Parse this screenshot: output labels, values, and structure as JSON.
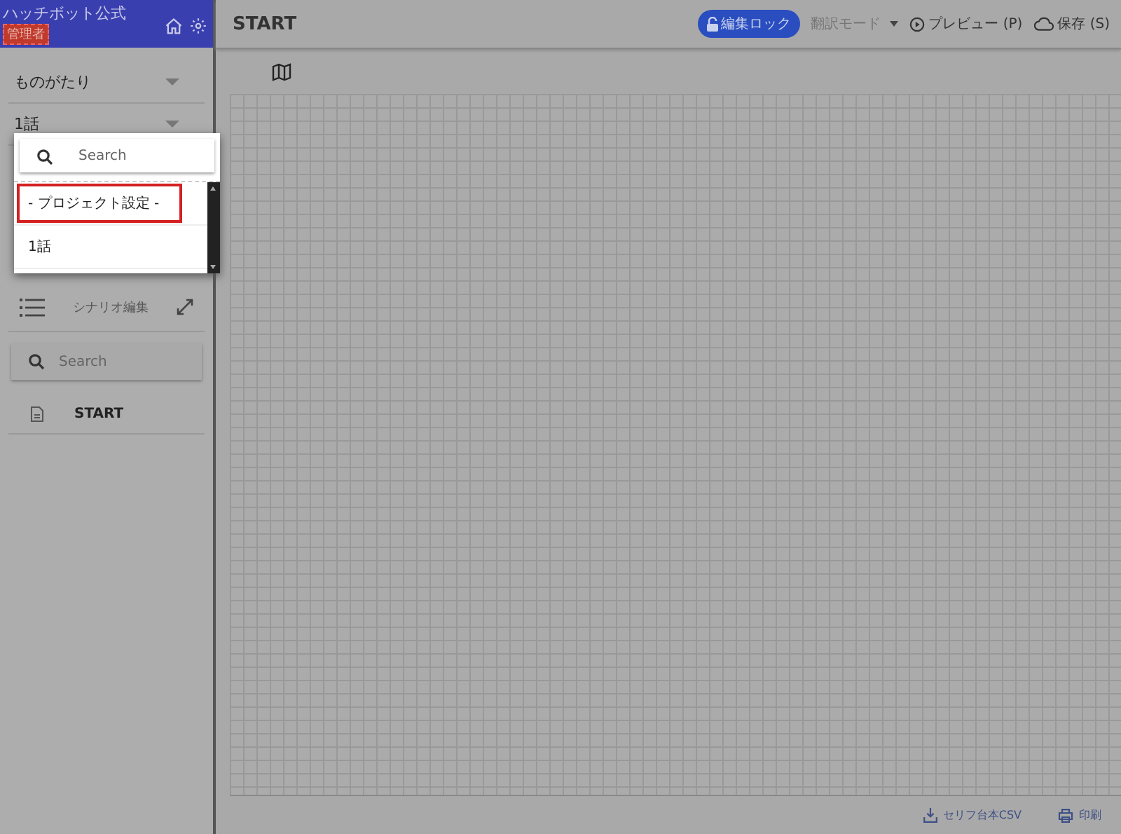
{
  "sidebar": {
    "app_title": "ハッチボット公式",
    "role_badge": "管理者",
    "selects": [
      {
        "label": "ものがたり"
      },
      {
        "label": "1話"
      }
    ],
    "scenario_label": "シナリオ編集",
    "search": {
      "placeholder": "Search"
    },
    "scenes": [
      {
        "label": "START"
      }
    ]
  },
  "dropdown": {
    "search": {
      "placeholder": "Search"
    },
    "options": [
      {
        "label": "- プロジェクト設定 -",
        "selected": true
      },
      {
        "label": "1話",
        "selected": false
      }
    ]
  },
  "header": {
    "title": "START",
    "edit_lock": "編集ロック",
    "translation_mode": "翻訳モード",
    "preview": "プレビュー (P)",
    "save": "保存 (S)"
  },
  "footer": {
    "csv_export": "セリフ台本CSV",
    "print": "印刷"
  }
}
